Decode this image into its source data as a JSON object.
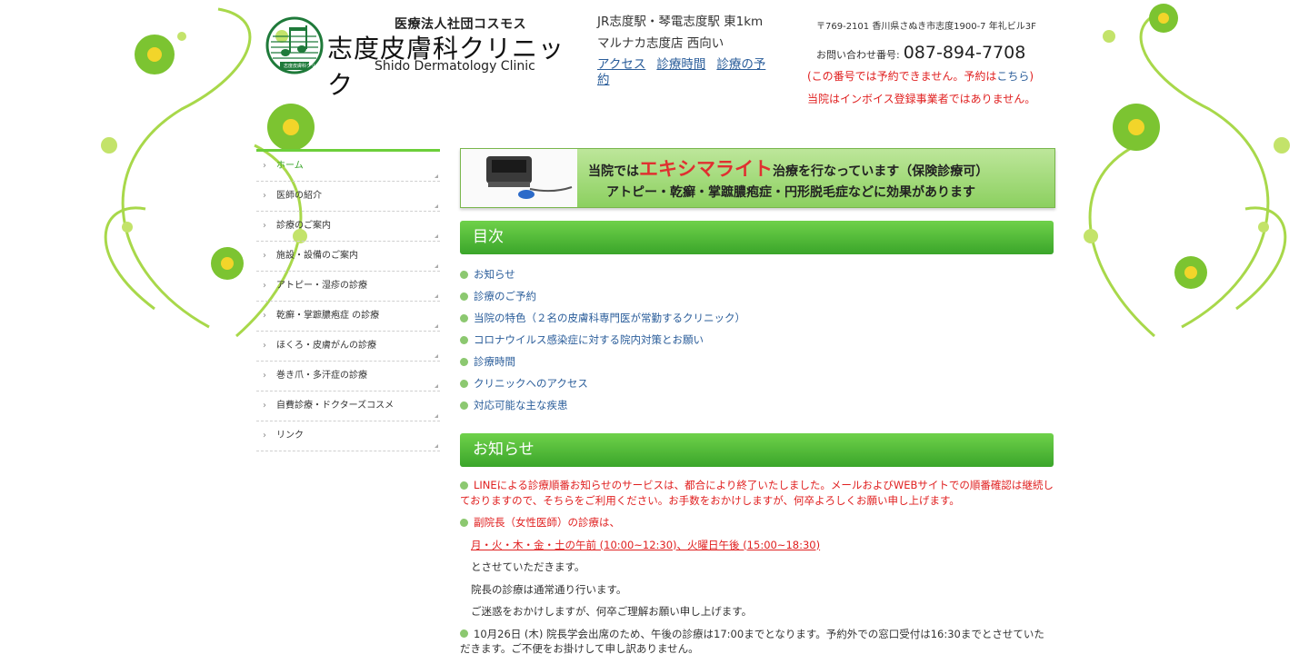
{
  "header": {
    "corp": "医療法人社団コスモス",
    "clinic_name": "志度皮膚科クリニック",
    "clinic_name_en": "Shido Dermatology Clinic",
    "logo_label": "志度皮膚科クリニック",
    "access_line1": "JR志度駅・琴電志度駅 東1km",
    "access_line2": "マルナカ志度店 西向い",
    "links": [
      "アクセス",
      "診療時間",
      "診療の予約"
    ],
    "address": "〒769-2101 香川県さぬき市志度1900-7 年礼ビル3F",
    "tel_label": "お問い合わせ番号:",
    "tel": "087-894-7708",
    "notice_prefix": "(この番号では予約できません。予約は",
    "notice_link": "こちら",
    "notice_suffix": ")",
    "invoice_notice": "当院はインボイス登録事業者ではありません。"
  },
  "sidebar": {
    "items": [
      {
        "label": "ホーム",
        "active": true
      },
      {
        "label": "医師の紹介"
      },
      {
        "label": "診療のご案内"
      },
      {
        "label": "施設・設備のご案内"
      },
      {
        "label": "アトピー・湿疹の診療"
      },
      {
        "label": "乾癬・掌蹠膿疱症 の診療"
      },
      {
        "label": "ほくろ・皮膚がんの診療"
      },
      {
        "label": "巻き爪・多汗症の診療"
      },
      {
        "label": "自費診療・ドクターズコスメ"
      },
      {
        "label": "リンク"
      }
    ]
  },
  "banner": {
    "line1_pre": "当院では",
    "line1_big": "エキシマライト",
    "line1_post": "治療を行なっています（保険診療可）",
    "line2": "アトピー・乾癬・掌蹠膿疱症・円形脱毛症などに効果があります"
  },
  "toc": {
    "title": "目次",
    "items": [
      "お知らせ",
      "診療のご予約",
      "当院の特色（２名の皮膚科専門医が常勤するクリニック）",
      "コロナウイルス感染症に対する院内対策とお願い",
      "診療時間",
      "クリニックへのアクセス",
      "対応可能な主な疾患"
    ]
  },
  "news": {
    "title": "お知らせ",
    "p1": "LINEによる診療順番お知らせのサービスは、都合により終了いたしました。メールおよびWEBサイトでの順番確認は継続しておりますので、そちらをご利用ください。お手数をおかけしますが、何卒よろしくお願い申し上げます。",
    "p2": "副院長（女性医師）の診療は、",
    "p2_schedule": "月・火・木・金・土の午前 (10:00~12:30)、火曜日午後 (15:00~18:30)",
    "p2_line3": "とさせていただきます。",
    "p2_line4": "院長の診療は通常通り行います。",
    "p2_line5": "ご迷惑をおかけしますが、何卒ご理解お願い申し上げます。",
    "p3": "10月26日 (木) 院長学会出席のため、午後の診療は17:00までとなります。予約外での窓口受付は16:30までとさせていただきます。ご不便をお掛けして申し訳ありません。"
  },
  "colors": {
    "accent_green": "#3aa52a",
    "link_blue": "#2a5d9a",
    "notice_red": "#e02020"
  }
}
